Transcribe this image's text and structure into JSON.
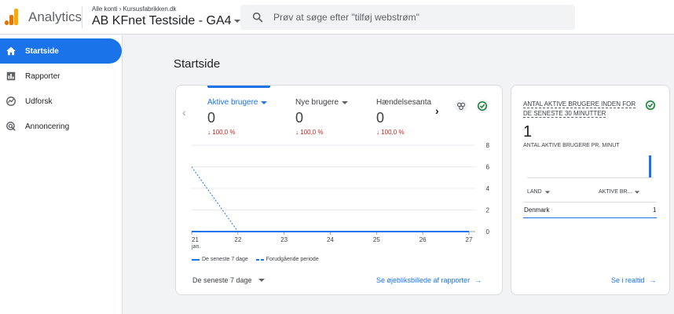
{
  "header": {
    "app_title": "Analytics",
    "breadcrumb": [
      "Alle konti",
      "Kursusfabrikken.dk"
    ],
    "property_name": "AB KFnet Testside - GA4",
    "search_placeholder": "Prøv at søge efter \"tilføj webstrøm\"",
    "logo_colors": [
      "#f9ab00",
      "#e37400",
      "#e37400"
    ]
  },
  "sidebar": {
    "items": [
      {
        "label": "Startside",
        "icon": "home-icon",
        "active": true
      },
      {
        "label": "Rapporter",
        "icon": "bar-chart-icon",
        "active": false
      },
      {
        "label": "Udforsk",
        "icon": "explore-icon",
        "active": false
      },
      {
        "label": "Annoncering",
        "icon": "advertising-icon",
        "active": false
      }
    ]
  },
  "main": {
    "page_title": "Startside",
    "metrics": [
      {
        "label": "Aktive brugere",
        "value": "0",
        "change": "↓ 100,0 %",
        "active": true
      },
      {
        "label": "Nye brugere",
        "value": "0",
        "change": "↓ 100,0 %",
        "active": false
      },
      {
        "label": "Hændelsesanta",
        "value": "0",
        "change": "↓ 100,0 %",
        "active": false
      }
    ],
    "legend": {
      "current": "De seneste 7 dage",
      "previous": "Forudgående periode"
    },
    "period_selector": "De seneste 7 dage",
    "report_link": "Se øjebliksbillede af rapporter"
  },
  "chart_data": {
    "type": "line",
    "x": [
      "21",
      "22",
      "23",
      "24",
      "25",
      "26",
      "27"
    ],
    "x_sublabel": "jan.",
    "yticks": [
      "0",
      "2",
      "4",
      "6",
      "8"
    ],
    "ylim": [
      0,
      8
    ],
    "series": [
      {
        "name": "De seneste 7 dage",
        "style": "solid",
        "values": [
          0,
          0,
          0,
          0,
          0,
          0,
          0
        ]
      },
      {
        "name": "Forudgående periode",
        "style": "dashed",
        "values": [
          6,
          0,
          0,
          0,
          0,
          0,
          0
        ]
      }
    ]
  },
  "realtime": {
    "title": "Antal aktive brugere inden for de seneste 30 minutter",
    "value": "1",
    "subtitle": "Antal aktive brugere pr. minut",
    "col_country": "LAND",
    "col_users": "AKTIVE BR...",
    "rows": [
      {
        "country": "Denmark",
        "users": "1"
      }
    ],
    "bars_per_minute": [
      0,
      0,
      0,
      0,
      0,
      0,
      0,
      0,
      0,
      0,
      0,
      0,
      0,
      0,
      0,
      0,
      0,
      0,
      0,
      0,
      0,
      0,
      0,
      0,
      0,
      0,
      0,
      0,
      0,
      1
    ],
    "link": "Se i realtid"
  },
  "colors": {
    "accent": "#1a73e8",
    "negative": "#c5221f",
    "check": "#188038"
  }
}
